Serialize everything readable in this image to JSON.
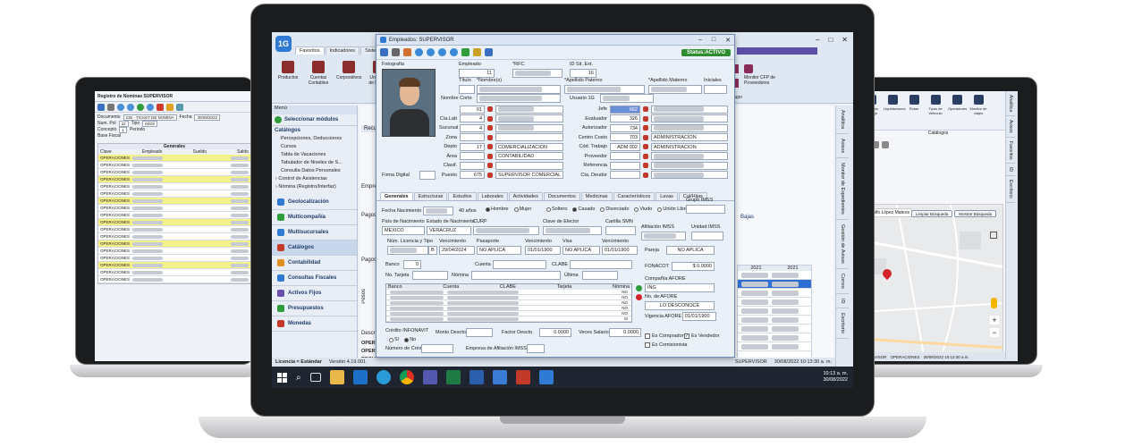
{
  "left_app": {
    "title": "Registro de Nominas SUPERVISOR",
    "fields": {
      "documento_label": "Documento",
      "documento_value": "230 - TICKET DE NOMINA",
      "num_pol_label": "Num. Pol",
      "num_pol_value": "22",
      "concepto_label": "Concepto",
      "concepto_value": "1",
      "base_fiscal_label": "Base Fiscal",
      "fecha_label": "Fecha",
      "fecha_value": "30/09/2022",
      "tipo_label": "Tipo",
      "tipo_value": "IMSS",
      "periodo_label": "Periodo"
    },
    "grid_header": [
      "Clave",
      "Empleado",
      "Sueldo",
      "Saldo"
    ],
    "grid_group": "Generales",
    "rows": [
      "OPERACIONES",
      "OPERACIONES",
      "OPERACIONES",
      "OPERACIONES",
      "OPERACIONES",
      "OPERACIONES",
      "OPERACIONES",
      "OPERACIONES",
      "OPERACIONES",
      "OPERACIONES",
      "OPERACIONES",
      "OPERACIONES",
      "OPERACIONES",
      "OPERACIONES",
      "OPERACIONES",
      "OPERACIONES",
      "OPERACIONES",
      "OPERACIONES"
    ]
  },
  "main_app": {
    "logo": "1G",
    "ribbon_tabs": [
      "Favoritos",
      "Indicadores",
      "Sistema"
    ],
    "ribbon_items": [
      "Productos",
      "Cuentas Contables",
      "Corporativos",
      "Unidades de Medida"
    ],
    "menu_label": "Menú",
    "select_modules": "Seleccionar módulos",
    "catalogs_header": "Catálogos",
    "catalog_items": [
      "Percepciones, Deducciones",
      "Cursos",
      "Tabla de Vacaciones",
      "Tabulador de Niveles de S...",
      "Consulta Datos Personales"
    ],
    "tree_items": [
      "Control de Asistencias",
      "Nómina (Registro/Interfaz)"
    ],
    "modules": [
      "Geolocalización",
      "Multicompañía",
      "Multisucursales",
      "Catálogos",
      "Contabilidad",
      "Consultas Fiscales",
      "Activos Fijos",
      "Presupuestos",
      "Monedas"
    ],
    "status_left": "Licencia = Estándar",
    "status_version": "Versión 4.19.001",
    "status_user": "SUPERVISOR",
    "status_date": "30/08/2022 10:13:30 a. m.",
    "right_ribbon": "Monitor CFP de Proveedores",
    "right_ribbon_group": "Grupo",
    "bg_labels": [
      "Recurso",
      "Empre",
      "Pagos",
      "Pagos"
    ],
    "bg_grid_header": [
      "2021",
      "2021"
    ],
    "bg_panel": "Pagos",
    "bg_tabs": "Bajas",
    "bg_panel_label": "Pesos",
    "bg_desc": "Descr",
    "bg_rows": [
      "OPER",
      "OPER",
      "REQU"
    ],
    "side_tabs": [
      "Analítica",
      "Avisos",
      "Monitor de Expedientes",
      "Gestión de Avisos",
      "Correo",
      "ID",
      "Escritorio"
    ]
  },
  "employee_window": {
    "title": "Empleados: SUPERVISOR",
    "status": "Status:ACTIVO",
    "labels": {
      "fotografia": "Fotografía",
      "empleado": "Empleado",
      "rfc": "*RFC",
      "id_sit_ext": "ID Sit. Ext.",
      "titulo": "Título",
      "nombres": "*Nombre(s)",
      "ap_paterno": "*Apellido Paterno",
      "ap_materno": "*Apellido Materno",
      "iniciales": "Iniciales",
      "nombre_corto": "Nombre Corto",
      "usuario": "Usuario 1G",
      "cia_lab": "Cía.Lab",
      "sucursal": "Sucursal",
      "zona": "Zona",
      "depto": "Depto",
      "area": "Área",
      "clasif": "Clasif.",
      "puesto": "Puesto",
      "firma": "Firma Digital",
      "jefe": "Jefe",
      "evaluador": "Evaluador",
      "autorizador": "Autorizador",
      "centro_costo": "Centro Costo",
      "cod_trabajo": "Cód. Trabajo",
      "proveedor": "Proveedor",
      "referencia": "Referencia",
      "cta_deudor": "Cta. Deudor"
    },
    "values": {
      "empleado": "11",
      "id_sit_ext": "16",
      "cia_lab": "4",
      "sucursal": "4",
      "depto": "17",
      "depto_name": "COMERCIALIZACION",
      "area_name": "CONTABILIDAD",
      "puesto": "675",
      "puesto_name": "SUPERVISOR COMERCIAL",
      "jefe": "662",
      "evaluador": "326",
      "autorizador": "734",
      "centro_costo": "703",
      "centro_costo_name": "ADMINISTRACION",
      "cod_trabajo": "ADM 002",
      "cod_trabajo_name": "ADMINISTRACION",
      "serie_emp": "01"
    },
    "tabs": [
      "Generales",
      "Estructuras",
      "Estudios",
      "Laborales",
      "Actividades",
      "Documentos",
      "Medicinas",
      "Característicos",
      "Lavas",
      "Cal/Hijas"
    ],
    "gen": {
      "fecha_nac": "Fecha Nacimiento",
      "edad": "40 años",
      "sexo_options": [
        "Hombre",
        "Mujer"
      ],
      "edo_civil_options": [
        "Soltero",
        "Casado",
        "Divorciado",
        "Viudo",
        "Unión Libre"
      ],
      "pais_nac": "País de Nacimiento",
      "estado_nac": "Estado de Nacimiento",
      "curp": "CURP",
      "clave_elector": "Clave de Elector",
      "cartilla": "Cartilla SMN",
      "pais_value": "MEXICO",
      "estado_value": "VERACRUZ",
      "grupo_imss": "Grupo IMSS",
      "afiliacion_imss": "Afiliación IMSS",
      "unidad_imss": "Unidad IMSS",
      "visa": "Núm. Licencia y Tipo",
      "vencimiento": "Vencimiento",
      "pasaporte": "Pasaporte",
      "visa_label": "Visa",
      "venc_value": "29/04/2024",
      "pasaporte_value": "NO APLICA",
      "pas_venc": "01/01/1900",
      "visa_value": "NO APLICA",
      "visa_venc": "01/01/1900",
      "licencia_tipo": "B",
      "pareja": "Pareja",
      "pareja_value": "NO APLICA",
      "banco": "Banco",
      "banco_value": "0",
      "cuenta": "Cuenta",
      "clabe": "CLABE",
      "tarjeta": "No. Tarjeta",
      "nomina": "Nómina",
      "forma_pago": "Última",
      "fonacot": "FONACOT",
      "fonacot_value": "$ 0.0000",
      "cia_afore": "Compañía AFORE",
      "cia_afore_value": "ING",
      "no_afore": "No. de AFORE",
      "no_afore_value": "LO DESCONOCE",
      "vigencia_afore": "Vigencia AFORE",
      "vigencia_value": "01/01/1900",
      "bank_grid_header": [
        "Banco",
        "Cuenta",
        "CLABE",
        "Tarjeta",
        "Nómina"
      ],
      "bank_rows": [
        "NO",
        "NO",
        "NO",
        "NO",
        "NO",
        "SI"
      ],
      "infonavit": "Crédito INFONAVIT",
      "monto_descto": "Monto Descto",
      "factor_descto": "Factor Descto",
      "factor_value": "0.0000",
      "veces_salario": "Veces Salario",
      "veces_value": "0.0000",
      "si_no": [
        "Sí",
        "No"
      ],
      "num_credito": "Número de Crédito",
      "empresa_imss": "Empresa de Afiliación IMSS",
      "comprador": "Es Comprador",
      "vendedor": "Es Vendedor",
      "comisionista": "Es Comisionista"
    }
  },
  "right_app": {
    "toolbar": [
      "Facturas de Viaje",
      "Liquidaciones",
      "Rutas",
      "Tipos de Vehículo",
      "Operadores",
      "Monitor de viajes"
    ],
    "group": "Catálogos",
    "map_search": "Adolfo López Mateos",
    "map_buttons": [
      "Limpiar Búsqueda",
      "Mostrar Búsqueda"
    ],
    "status_left": "...",
    "status_user": "SUPERVISOR",
    "status_op": "OPERACIONES",
    "status_date": "30/08/2022 10:13:30 a.m.",
    "side_tabs": [
      "Analítica",
      "Avisos",
      "Favoritos",
      "ID",
      "Escritorio"
    ]
  },
  "taskbar": {
    "time": "10:13 a. m.",
    "date": "30/08/2022"
  },
  "colors": {
    "accent": "#1e5aa8",
    "status_green": "#2e8b2e",
    "highlight": "#f4f08a",
    "laptop_bezel": "#1b1c1e",
    "mapred": "#d2232a"
  }
}
